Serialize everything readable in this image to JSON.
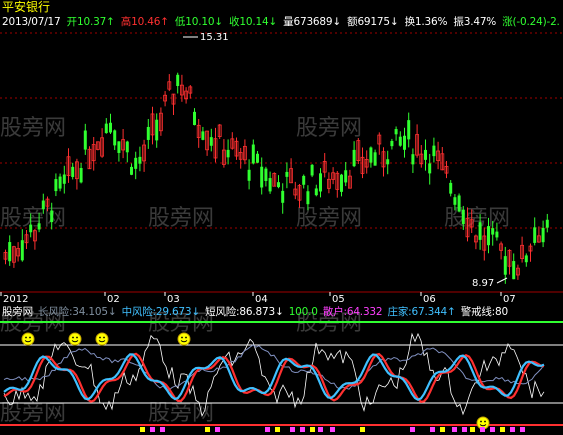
{
  "stock": {
    "name": "平安银行"
  },
  "quote": {
    "date": "2013/07/17",
    "open_label": "开",
    "open": "10.37",
    "open_arrow": "↑",
    "high_label": "高",
    "high": "10.46",
    "high_arrow": "↑",
    "low_label": "低",
    "low": "10.10",
    "low_arrow": "↓",
    "close_label": "收",
    "close": "10.14",
    "close_arrow": "↓",
    "volume_label": "量",
    "volume": "673689",
    "volume_arrow": "↓",
    "amount_label": "额",
    "amount": "69175",
    "amount_arrow": "↓",
    "turnover_label": "换",
    "turnover": "1.36%",
    "amplitude_label": "振",
    "amplitude": "3.47%",
    "change_label": "涨",
    "change": "(-0.24)-2."
  },
  "price_chart": {
    "max_label": "15.31",
    "min_label": "8.97",
    "months": [
      "2012",
      "02",
      "03",
      "04",
      "05",
      "06",
      "07"
    ]
  },
  "indicator": {
    "name": "股旁网",
    "long_risk": {
      "label": "长风险:",
      "value": "34.105",
      "arrow": "↓"
    },
    "mid_risk": {
      "label": "中风险:",
      "value": "29.673",
      "arrow": "↓"
    },
    "short_risk": {
      "label": "短风险:",
      "value": "86.873",
      "arrow": "↓"
    },
    "level_value": "100.0",
    "retail": {
      "label": "散户:",
      "value": "64.332"
    },
    "dealer": {
      "label": "庄家:",
      "value": "67.344",
      "arrow": "↑"
    },
    "alert": {
      "label": "警戒线:",
      "value": "80"
    }
  },
  "watermark": "股旁网",
  "colors": {
    "up": "#ff3030",
    "down": "#30ff30",
    "grid": "#a00000",
    "white_line": "#ffffff",
    "cyan_line": "#40c0ff",
    "alert_line": "#ff3030"
  }
}
